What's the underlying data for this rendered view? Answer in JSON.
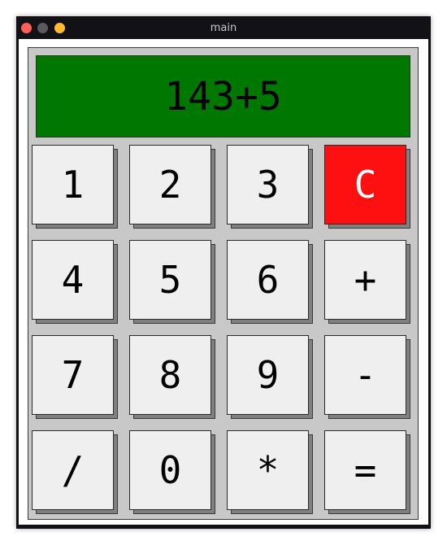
{
  "window": {
    "title": "main",
    "traffic_colors": {
      "close": "#ff5f57",
      "minimize": "#5a5a5e",
      "zoom": "#febc2e"
    }
  },
  "display": {
    "value": "143+5",
    "background": "#007800"
  },
  "keys": [
    {
      "label": "1",
      "name": "key-1-button"
    },
    {
      "label": "2",
      "name": "key-2-button"
    },
    {
      "label": "3",
      "name": "key-3-button"
    },
    {
      "label": "C",
      "name": "clear-button",
      "background": "#fe1010",
      "color": "#ffffff"
    },
    {
      "label": "4",
      "name": "key-4-button"
    },
    {
      "label": "5",
      "name": "key-5-button"
    },
    {
      "label": "6",
      "name": "key-6-button"
    },
    {
      "label": "+",
      "name": "plus-button"
    },
    {
      "label": "7",
      "name": "key-7-button"
    },
    {
      "label": "8",
      "name": "key-8-button"
    },
    {
      "label": "9",
      "name": "key-9-button"
    },
    {
      "label": "-",
      "name": "minus-button"
    },
    {
      "label": "/",
      "name": "divide-button"
    },
    {
      "label": "0",
      "name": "key-0-button"
    },
    {
      "label": "*",
      "name": "multiply-button"
    },
    {
      "label": "=",
      "name": "equals-button"
    }
  ]
}
